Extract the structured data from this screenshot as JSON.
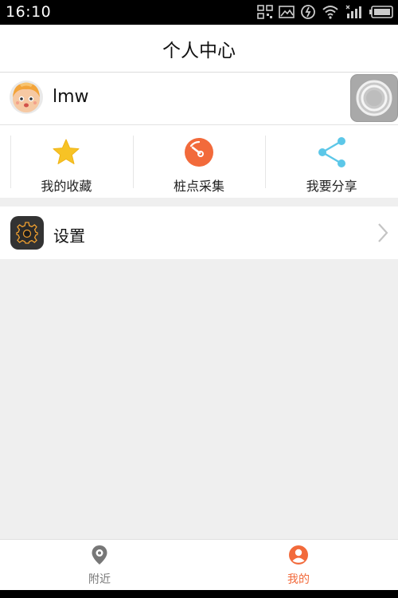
{
  "status_bar": {
    "time": "16:10"
  },
  "header": {
    "title": "个人中心"
  },
  "profile": {
    "username": "lmw"
  },
  "actions": [
    {
      "label": "我的收藏",
      "icon": "star-icon"
    },
    {
      "label": "桩点采集",
      "icon": "gauge-icon"
    },
    {
      "label": "我要分享",
      "icon": "share-icon"
    }
  ],
  "settings": {
    "label": "设置",
    "icon": "settings-gear-icon"
  },
  "tabs": [
    {
      "label": "附近",
      "icon": "location-pin-icon",
      "active": false
    },
    {
      "label": "我的",
      "icon": "profile-icon",
      "active": true
    }
  ],
  "colors": {
    "accent": "#f26a3b",
    "star": "#f7c325",
    "share": "#5cc7e8",
    "tab_inactive": "#777777",
    "background": "#efefef"
  }
}
